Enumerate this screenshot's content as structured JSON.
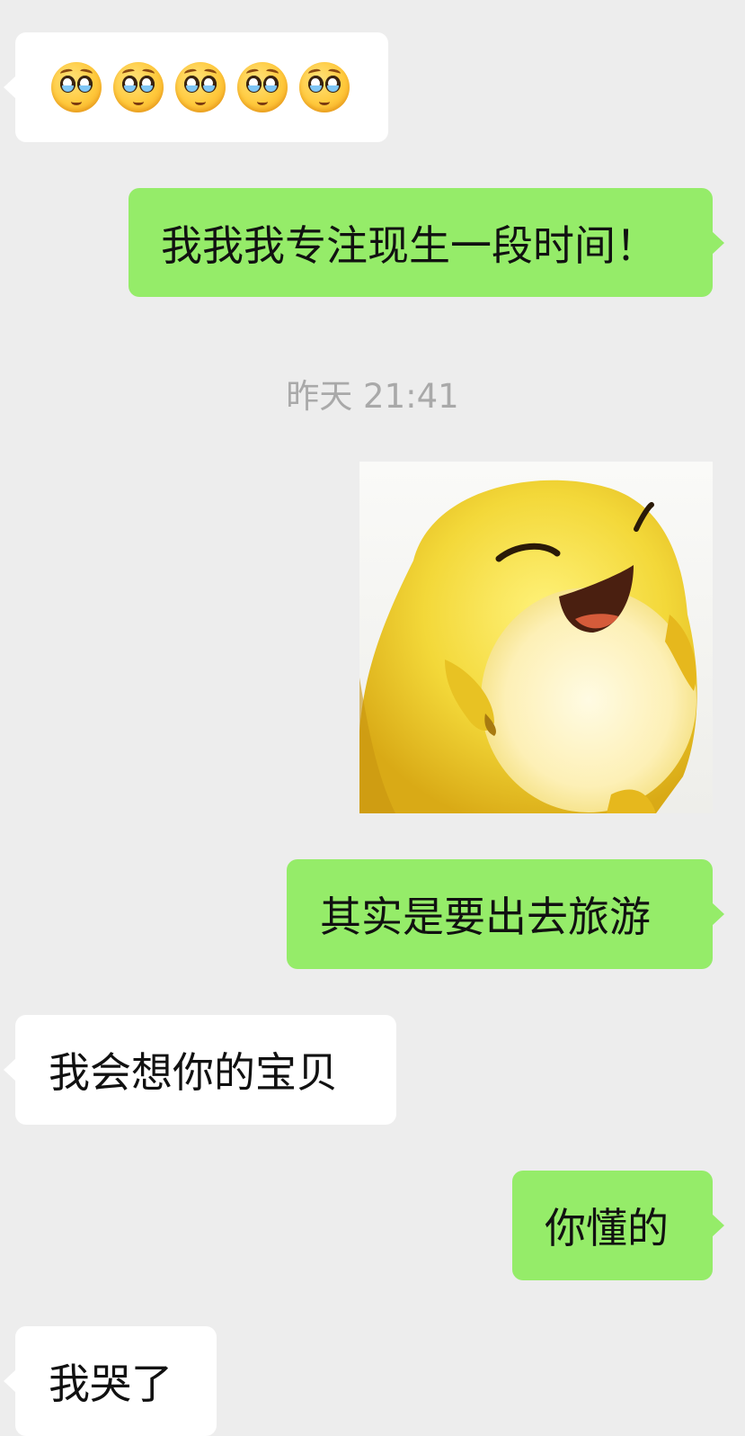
{
  "messages": [
    {
      "side": "in",
      "emoji_icons": [
        "pleading-face-icon",
        "pleading-face-icon",
        "pleading-face-icon",
        "pleading-face-icon",
        "pleading-face-icon"
      ]
    },
    {
      "side": "out",
      "text": "我我我专注现生一段时间！"
    },
    {
      "timestamp": "昨天 21:41"
    },
    {
      "side": "out",
      "sticker": "yellow-chick-laughing-sticker"
    },
    {
      "side": "out",
      "text": "其实是要出去旅游"
    },
    {
      "side": "in",
      "text": "我会想你的宝贝"
    },
    {
      "side": "out",
      "text": "你懂的"
    },
    {
      "side": "in",
      "text": "我哭了"
    }
  ],
  "colors": {
    "background": "#ededed",
    "incoming_bubble": "#ffffff",
    "outgoing_bubble": "#95ec69",
    "timestamp_text": "#a9a9a9"
  }
}
